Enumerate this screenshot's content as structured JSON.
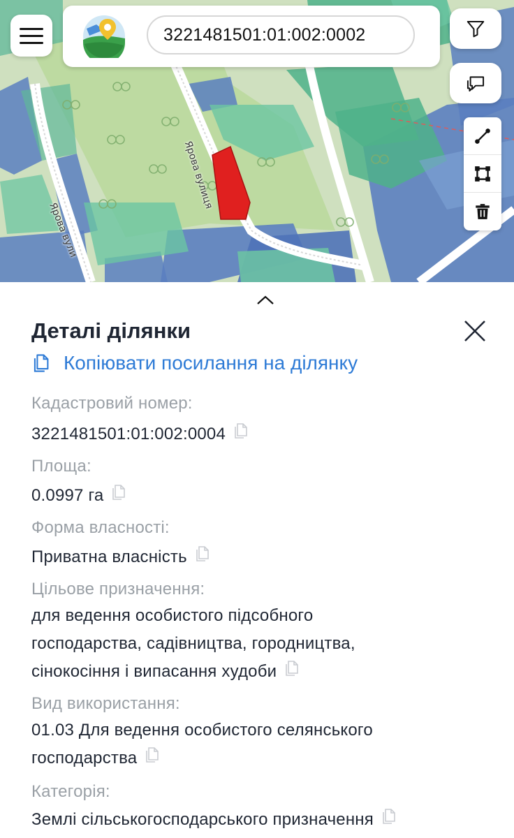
{
  "map": {
    "street_labels": [
      "Ярова вулиця",
      "Ярова вули"
    ],
    "highlight_color": "#e0201f"
  },
  "topbar": {
    "search_value": "3221481501:01:002:0002",
    "icons": [
      "menu-icon",
      "app-logo-icon",
      "filter-icon",
      "feedback-icon"
    ]
  },
  "tools": [
    "measure-line-icon",
    "measure-area-icon",
    "trash-icon"
  ],
  "panel": {
    "title": "Деталі ділянки",
    "copy_link_label": "Копіювати посилання на ділянку",
    "fields": [
      {
        "label": "Кадастровий номер:",
        "value": "3221481501:01:002:0004"
      },
      {
        "label": "Площа:",
        "value": "0.0997 га"
      },
      {
        "label": "Форма власності:",
        "value": "Приватна власність"
      },
      {
        "label": "Цільове призначення:",
        "value_lines": [
          "для ведення особистого підсобного",
          "господарства, садівництва, городництва,",
          "сінокосіння і випасання худоби"
        ]
      },
      {
        "label": "Вид використання:",
        "value_lines": [
          "01.03 Для ведення особистого селянського",
          "господарства"
        ]
      },
      {
        "label": "Категорія:",
        "value": "Землі сільськогосподарського призначення"
      }
    ]
  },
  "colors": {
    "link": "#2e7bd6",
    "label": "#9aa0a6",
    "text": "#1f2633"
  }
}
